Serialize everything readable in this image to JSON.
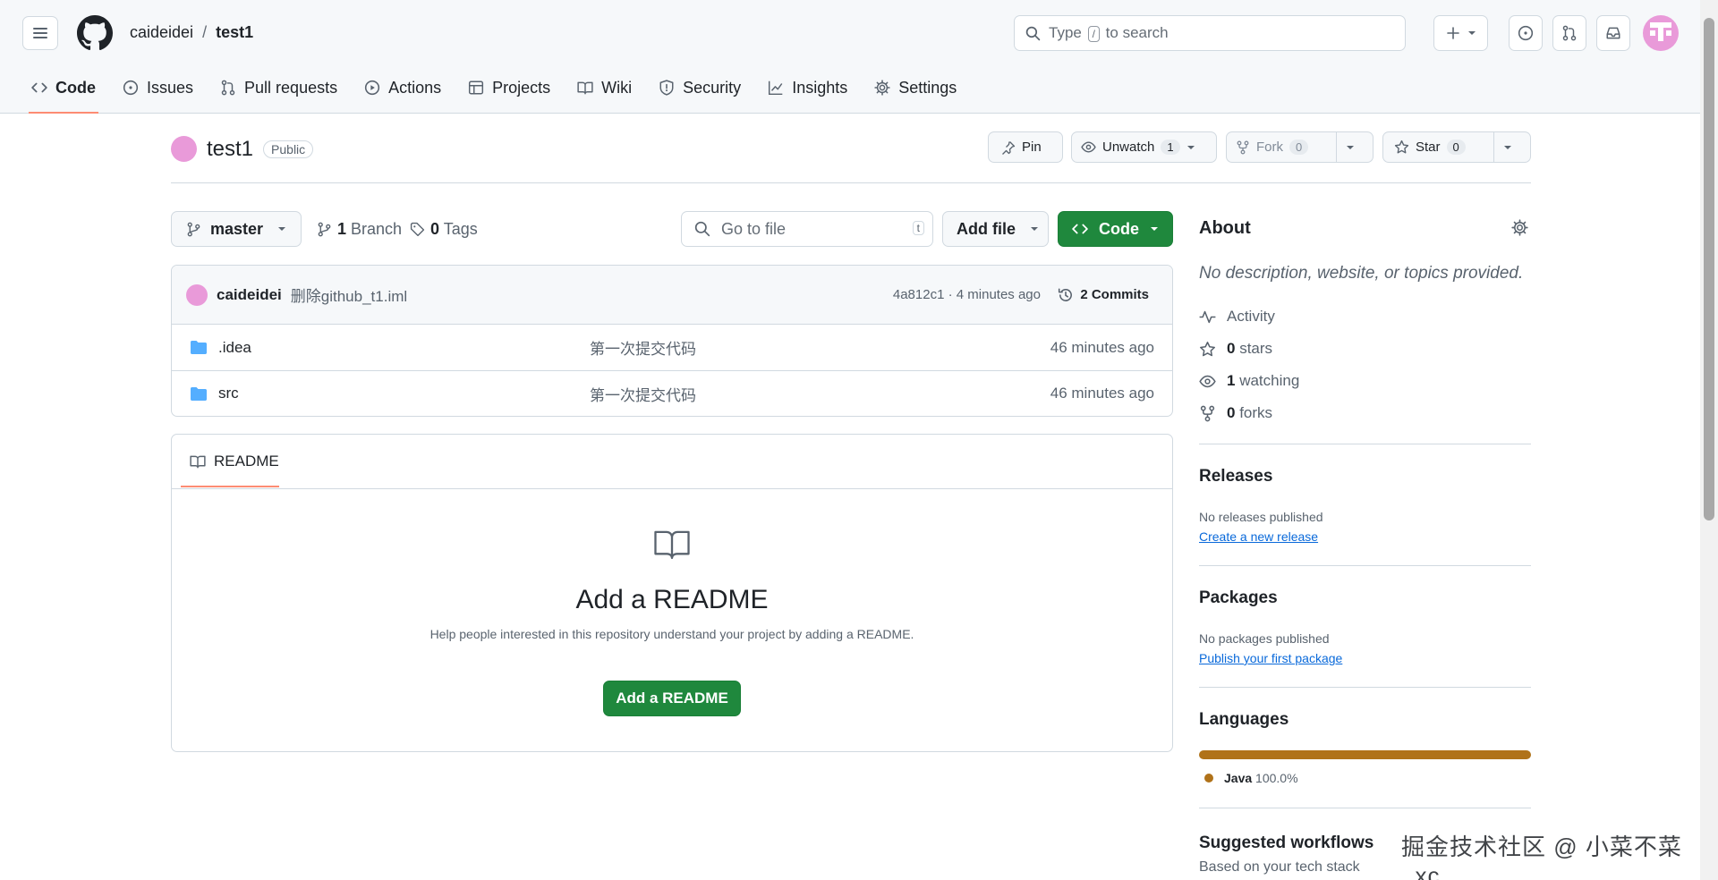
{
  "header": {
    "owner": "caideidei",
    "separator": "/",
    "repo": "test1",
    "search_text_pre": "Type",
    "search_key": "/",
    "search_text_post": "to search"
  },
  "tabs": [
    {
      "label": "Code",
      "icon": "code-icon"
    },
    {
      "label": "Issues",
      "icon": "issue-icon"
    },
    {
      "label": "Pull requests",
      "icon": "pull-request-icon"
    },
    {
      "label": "Actions",
      "icon": "play-icon"
    },
    {
      "label": "Projects",
      "icon": "table-icon"
    },
    {
      "label": "Wiki",
      "icon": "book-icon"
    },
    {
      "label": "Security",
      "icon": "shield-icon"
    },
    {
      "label": "Insights",
      "icon": "graph-icon"
    },
    {
      "label": "Settings",
      "icon": "gear-icon"
    }
  ],
  "repo": {
    "name": "test1",
    "visibility": "Public",
    "pin_label": "Pin",
    "unwatch_label": "Unwatch",
    "unwatch_count": "1",
    "fork_label": "Fork",
    "fork_count": "0",
    "star_label": "Star",
    "star_count": "0"
  },
  "toolbar": {
    "branch": "master",
    "branch_count": "1",
    "branch_label": "Branch",
    "tag_count": "0",
    "tag_label": "Tags",
    "goto_placeholder": "Go to file",
    "goto_key": "t",
    "add_file": "Add file",
    "code": "Code"
  },
  "commit": {
    "author": "caideidei",
    "message": "删除github_t1.iml",
    "hash_time": "4a812c1 · 4 minutes ago",
    "commits_label": "2 Commits"
  },
  "files": [
    {
      "name": ".idea",
      "message": "第一次提交代码",
      "time": "46 minutes ago"
    },
    {
      "name": "src",
      "message": "第一次提交代码",
      "time": "46 minutes ago"
    }
  ],
  "readme": {
    "tab": "README",
    "heading": "Add a README",
    "text": "Help people interested in this repository understand your project by adding a README.",
    "button": "Add a README"
  },
  "about": {
    "title": "About",
    "description": "No description, website, or topics provided.",
    "activity": "Activity",
    "stars_count": "0",
    "stars_label": "stars",
    "watching_count": "1",
    "watching_label": "watching",
    "forks_count": "0",
    "forks_label": "forks"
  },
  "releases": {
    "title": "Releases",
    "none": "No releases published",
    "link": "Create a new release"
  },
  "packages": {
    "title": "Packages",
    "none": "No packages published",
    "link": "Publish your first package"
  },
  "languages": {
    "title": "Languages",
    "name": "Java",
    "percent": "100.0%",
    "color": "#b07219"
  },
  "workflows": {
    "title": "Suggested workflows",
    "subtitle": "Based on your tech stack"
  },
  "watermark": "掘金技术社区 @ 小菜不菜_xc"
}
